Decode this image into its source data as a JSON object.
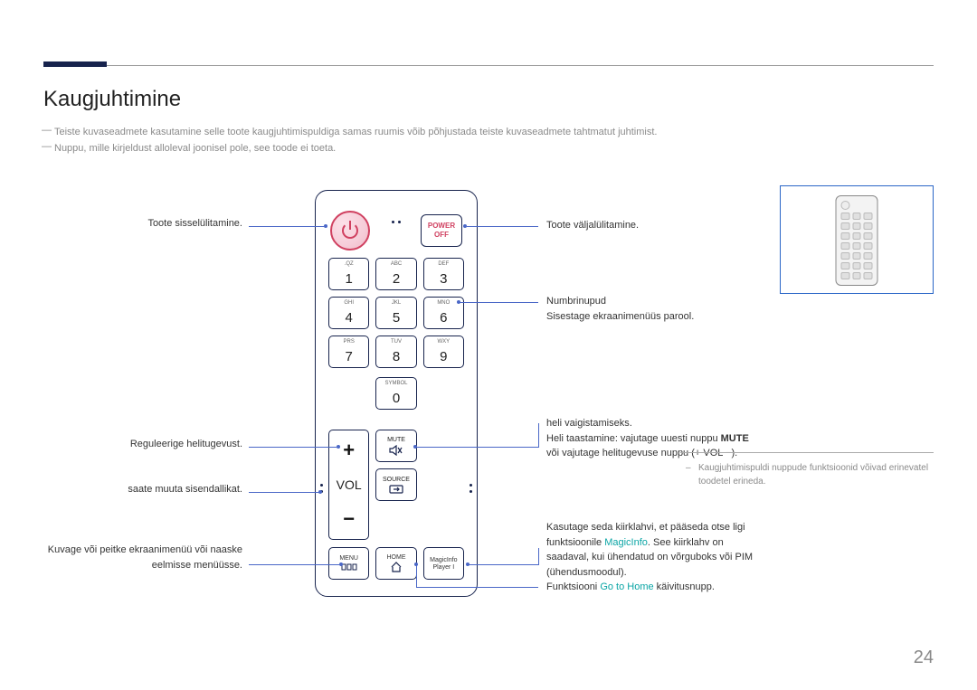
{
  "page": {
    "title": "Kaugjuhtimine",
    "page_number": "24",
    "note1": "Teiste kuvaseadmete kasutamine selle toote kaugjuhtimispuldiga samas ruumis võib põhjustada teiste kuvaseadmete tahtmatut juhtimist.",
    "note2": "Nuppu, mille kirjeldust alloleval joonisel pole, see toode ei toeta.",
    "sidenote": "Kaugjuhtimispuldi nuppude funktsioonid võivad erinevatel toodetel erineda."
  },
  "remote": {
    "power_off": {
      "line1": "POWER",
      "line2": "OFF"
    },
    "keypad": [
      {
        "num": "1",
        "sub": ".QZ"
      },
      {
        "num": "2",
        "sub": "ABC"
      },
      {
        "num": "3",
        "sub": "DEF"
      },
      {
        "num": "4",
        "sub": "GHI"
      },
      {
        "num": "5",
        "sub": "JKL"
      },
      {
        "num": "6",
        "sub": "MNO"
      },
      {
        "num": "7",
        "sub": "PRS"
      },
      {
        "num": "8",
        "sub": "TUV"
      },
      {
        "num": "9",
        "sub": "WXY"
      }
    ],
    "zero": {
      "num": "0",
      "sub": "SYMBOL"
    },
    "vol_label": "VOL",
    "mute_label": "MUTE",
    "source_label": "SOURCE",
    "menu_label": "MENU",
    "home_label": "HOME",
    "magicinfo": {
      "line1": "MagicInfo",
      "line2": "Player I"
    }
  },
  "labels": {
    "left": {
      "power_on": "Toote sisselülitamine.",
      "volume": "Reguleerige helitugevust.",
      "source": "saate muuta sisendallikat.",
      "menu": "Kuvage või peitke ekraanimenüü või naaske eelmisse menüüsse."
    },
    "right": {
      "power_off": "Toote väljalülitamine.",
      "numbers_title": "Numbrinupud",
      "numbers_desc": "Sisestage ekraanimenüüs parool.",
      "mute_title": "heli vaigistamiseks.",
      "mute_desc_prefix": "Heli taastamine: vajutage uuesti nuppu ",
      "mute_bold": "MUTE",
      "mute_desc_suffix": " või vajutage helitugevuse nuppu (+ VOL −).",
      "magicinfo_prefix": "Kasutage seda kiirklahvi, et pääseda otse ligi funktsioonile ",
      "magicinfo_link": "MagicInfo",
      "magicinfo_suffix": ". See kiirklahv on saadaval, kui ühendatud on võrguboks või PIM (ühendusmoodul).",
      "home_prefix": "Funktsiooni ",
      "home_teal": "Go to Home",
      "home_suffix": " käivitusnupp."
    }
  }
}
